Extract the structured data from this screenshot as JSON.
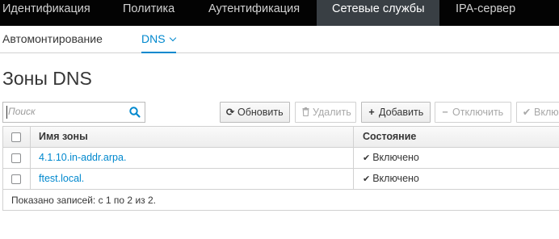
{
  "top_nav": {
    "items": [
      {
        "label": "Идентификация"
      },
      {
        "label": "Политика"
      },
      {
        "label": "Аутентификация"
      },
      {
        "label": "Сетевые службы",
        "active": true
      },
      {
        "label": "IPA-сервер"
      }
    ]
  },
  "sub_nav": {
    "items": [
      {
        "label": "Автомонтирование"
      },
      {
        "label": "DNS",
        "active": true,
        "has_dropdown": true
      }
    ]
  },
  "page": {
    "title": "Зоны DNS"
  },
  "search": {
    "placeholder": "Поиск",
    "value": "",
    "icon": "search-icon"
  },
  "toolbar": {
    "refresh": {
      "label": "Обновить",
      "icon": "refresh-icon",
      "enabled": true
    },
    "delete": {
      "label": "Удалить",
      "icon": "trash-icon",
      "enabled": false
    },
    "add": {
      "label": "Добавить",
      "icon": "plus-icon",
      "enabled": true
    },
    "disable": {
      "label": "Отключить",
      "icon": "minus-icon",
      "enabled": false
    },
    "enable": {
      "label": "Вклю",
      "icon": "check-icon",
      "enabled": false
    }
  },
  "table": {
    "columns": [
      "Имя зоны",
      "Состояние"
    ],
    "rows": [
      {
        "zone": "4.1.10.in-addr.arpa.",
        "state": "Включено"
      },
      {
        "zone": "ftest.local.",
        "state": "Включено"
      }
    ],
    "footer": "Показано записей: с 1 по 2 из 2."
  },
  "colors": {
    "top_nav_bg": "#030303",
    "top_nav_active_bg": "#393f44",
    "accent": "#0088ce",
    "border": "#d1d1d1"
  }
}
